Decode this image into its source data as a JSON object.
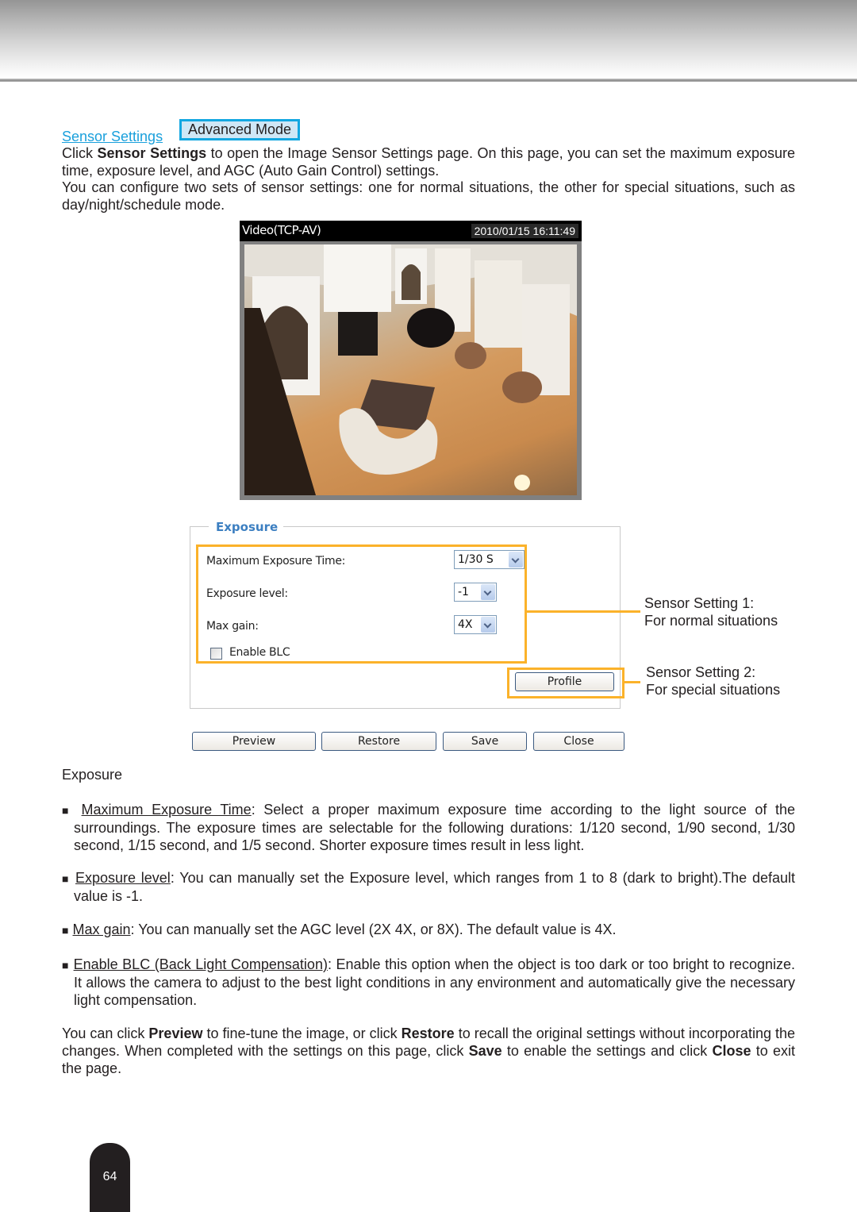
{
  "header": {},
  "intro": {
    "sensor_settings_link": "Sensor Settings",
    "advanced_mode_badge": "Advanced Mode",
    "p1_pre": "Click ",
    "p1_bold": "Sensor Settings",
    "p1_post": " to open the Image Sensor Settings page. On this page, you can set the maximum exposure time, exposure level, and AGC (Auto Gain Control) settings.",
    "p2": "You can configure two sets of sensor settings: one for normal situations, the other for special situations, such as day/night/schedule mode."
  },
  "video": {
    "title": "Video(TCP-AV)",
    "timestamp": "2010/01/15 16:11:49"
  },
  "exposure_panel": {
    "legend": "Exposure",
    "fields": [
      {
        "label": "Maximum Exposure Time:",
        "value": "1/30 S"
      },
      {
        "label": "Exposure level:",
        "value": "-1"
      },
      {
        "label": "Max gain:",
        "value": "4X"
      }
    ],
    "blc_label": "Enable BLC",
    "blc_checked": false,
    "profile_button": "Profile"
  },
  "annotations": {
    "setting1_line1": "Sensor Setting 1:",
    "setting1_line2": "For normal situations",
    "setting2_line1": "Sensor Setting 2:",
    "setting2_line2": "For special situations"
  },
  "buttons": {
    "preview": "Preview",
    "restore": "Restore",
    "save": "Save",
    "close": "Close"
  },
  "body": {
    "section_heading": "Exposure",
    "bullet_glyph": "■",
    "items": [
      {
        "term": "Maximum Exposure Time",
        "text": ": Select a proper maximum exposure time according to the light source of the surroundings. The exposure times are selectable for the following durations: 1/120 second, 1/90 second, 1/30 second, 1/15 second, and 1/5 second. Shorter exposure times result in less light."
      },
      {
        "term": "Exposure level",
        "text": ": You can manually set the Exposure level, which ranges from 1 to 8 (dark to bright).The default value is -1."
      },
      {
        "term": "Max gain",
        "text": ": You can manually set the AGC level (2X 4X, or 8X). The default value is 4X."
      },
      {
        "term": "Enable BLC (Back Light Compensation)",
        "text": ": Enable this option when the object is too dark or too bright to recognize. It allows the camera to adjust to the best light conditions in any environment and automatically give the necessary light compensation."
      }
    ],
    "closing": {
      "t1": "You can click ",
      "b1": "Preview",
      "t2": " to fine-tune the image, or click ",
      "b2": "Restore",
      "t3": " to recall the original settings without incorporating the changes. When completed with the settings on this page, click ",
      "b3": "Save",
      "t4": " to enable the settings and click ",
      "b4": "Close",
      "t5": " to exit the page."
    }
  },
  "footer": {
    "page_number": "64"
  }
}
